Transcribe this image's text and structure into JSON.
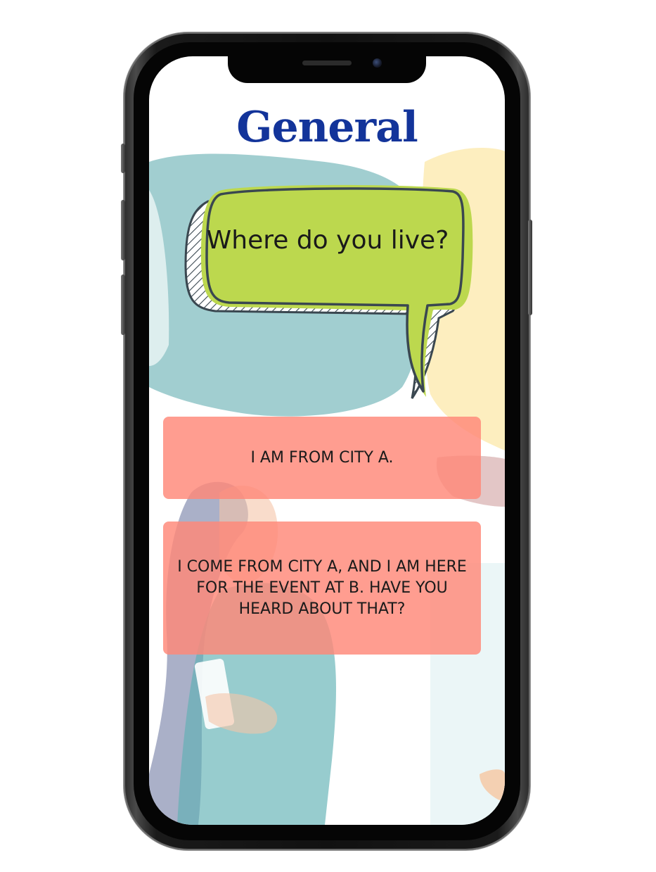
{
  "screen": {
    "title": "General",
    "question": "Where do you live?",
    "answers": [
      {
        "label": "I AM FROM CITY A."
      },
      {
        "label": "I COME FROM CITY A, AND I AM HERE FOR THE EVENT AT B. HAVE YOU HEARD ABOUT THAT?"
      }
    ]
  },
  "colors": {
    "title": "#13349a",
    "bubble": "#bcd84e",
    "answer_bg": "#ff8778",
    "accent_teal": "#8fc6c8",
    "accent_yellow": "#fde9b0"
  }
}
